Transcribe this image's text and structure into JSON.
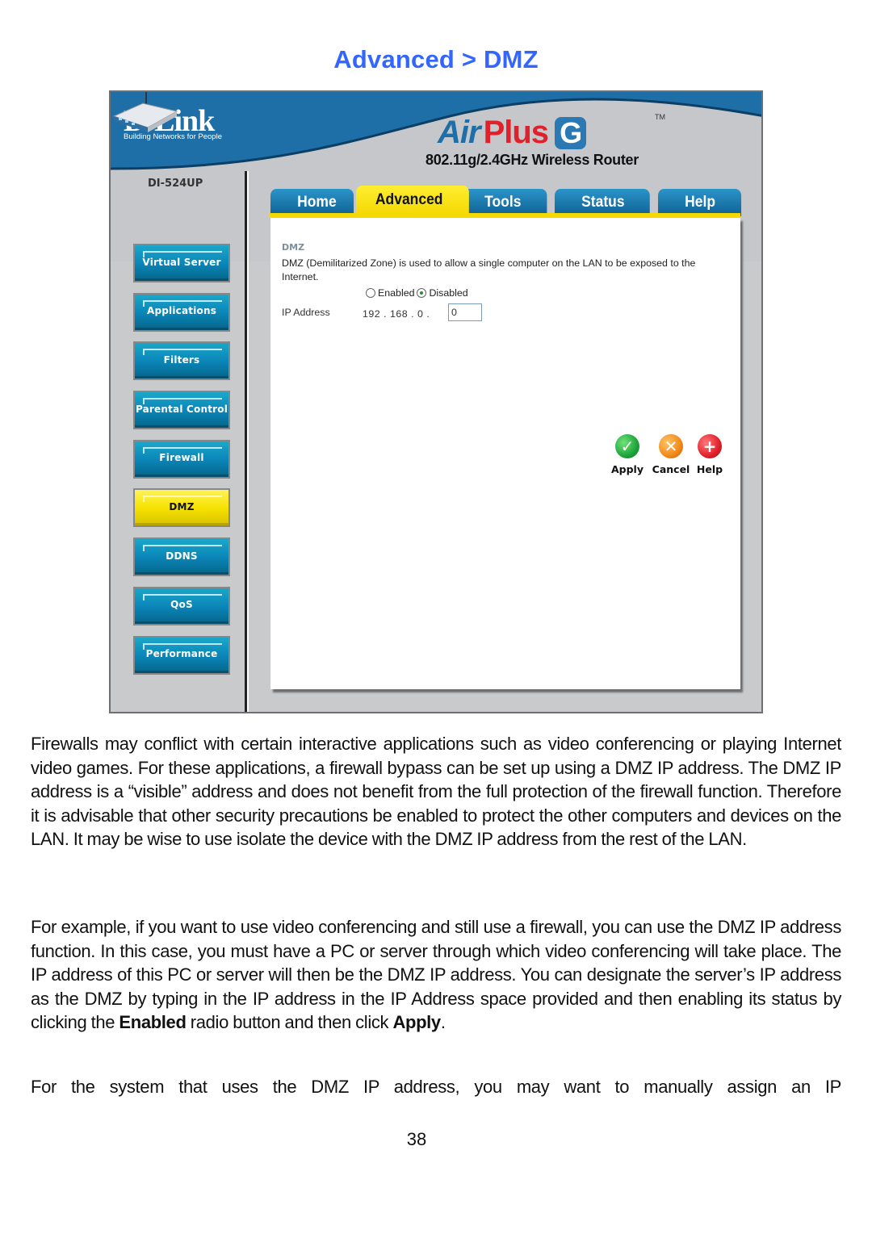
{
  "page": {
    "heading": "Advanced > DMZ",
    "page_number": "38"
  },
  "router_ui": {
    "brand": {
      "logo": "D-Link",
      "tagline": "Building Networks for People",
      "product_air": "Air",
      "product_plus": "Plus",
      "product_g": "G",
      "trademark": "TM",
      "subtitle": "802.11g/2.4GHz Wireless Router",
      "model": "DI-524UP"
    },
    "tabs": [
      {
        "label": "Home",
        "active": false
      },
      {
        "label": "Advanced",
        "active": true
      },
      {
        "label": "Tools",
        "active": false
      },
      {
        "label": "Status",
        "active": false
      },
      {
        "label": "Help",
        "active": false
      }
    ],
    "sidebar": {
      "items": [
        {
          "label": "Virtual Server",
          "active": false
        },
        {
          "label": "Applications",
          "active": false
        },
        {
          "label": "Filters",
          "active": false
        },
        {
          "label": "Parental Control",
          "active": false
        },
        {
          "label": "Firewall",
          "active": false
        },
        {
          "label": "DMZ",
          "active": true
        },
        {
          "label": "DDNS",
          "active": false
        },
        {
          "label": "QoS",
          "active": false
        },
        {
          "label": "Performance",
          "active": false
        }
      ]
    },
    "panel": {
      "title": "DMZ",
      "description": "DMZ (Demilitarized Zone) is used to allow a single computer on the LAN to be exposed to the Internet.",
      "radio_enabled_label": "Enabled",
      "radio_disabled_label": "Disabled",
      "selected": "Disabled",
      "ip_label": "IP Address",
      "ip_prefix": "192 . 168 . 0 .",
      "ip_last_octet": "0"
    },
    "actions": {
      "apply": "Apply",
      "cancel": "Cancel",
      "help": "Help"
    },
    "colors": {
      "banner_blue": "#1e6fa8",
      "tab_active": "#f5d900",
      "nav_button": "#0a86b8",
      "nav_active": "#f6e200",
      "heading_blue": "#3366ff"
    }
  },
  "body": {
    "paragraph1": "Firewalls may conflict with certain interactive applications such as video conferencing or playing Internet video games. For these applications, a firewall bypass can be set up using a DMZ IP address. The DMZ IP address is a “visible” address and does not benefit from the full protection of the firewall function. Therefore it is advisable that other security precautions be enabled to protect the other computers and devices on the LAN. It may be wise to use isolate the device with the DMZ IP address from the rest of the LAN.",
    "paragraph2_main": "For example, if you want to use video conferencing and still use a firewall, you can use the DMZ IP address function. In this case, you must have a PC or server through which video conferencing will take place. The IP address of this PC or server will then be the DMZ IP address. You can designate the server’s IP address as the DMZ by typing in the IP address in the IP Address space provided and then enabling its status by clicking the",
    "paragraph2_bold1": "Enabled",
    "paragraph2_mid": " radio button and then click ",
    "paragraph2_bold2": "Apply",
    "paragraph2_end": ".",
    "paragraph3": "For the system that uses the DMZ IP address, you may want to manually assign an IP"
  }
}
